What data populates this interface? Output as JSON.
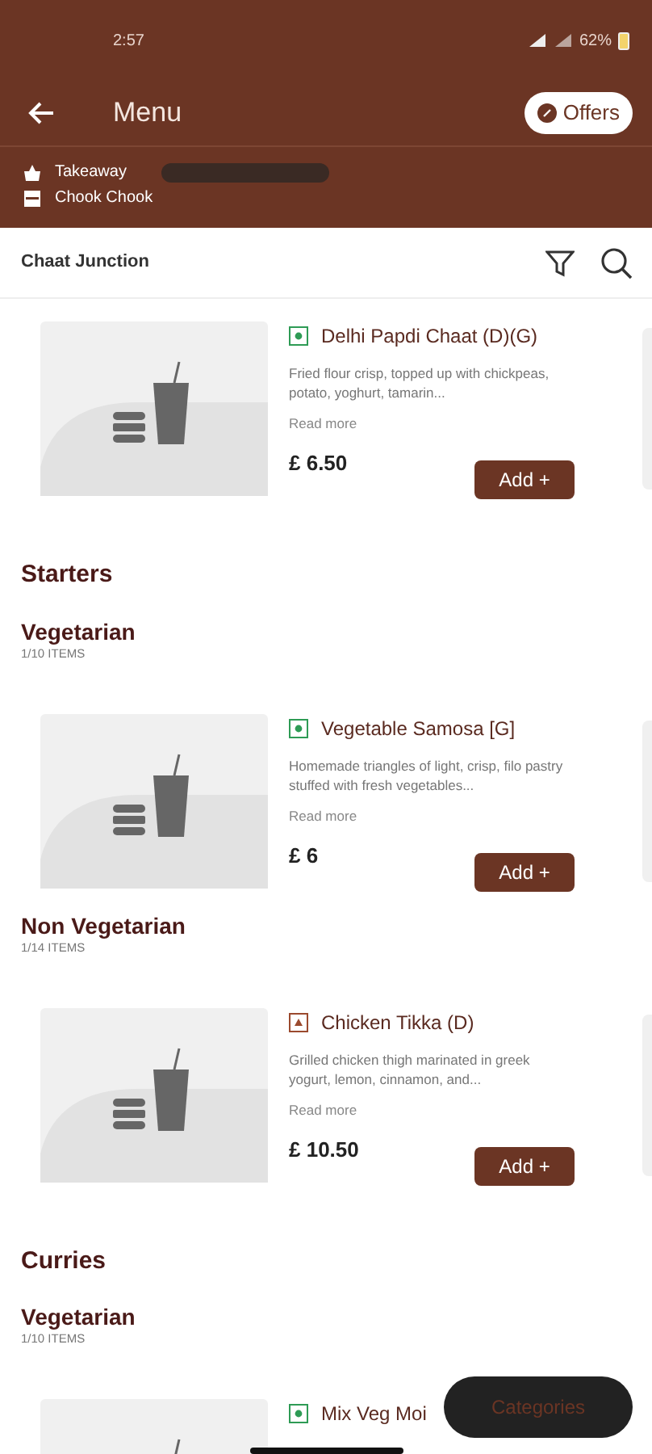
{
  "status_bar": {
    "time": "2:57",
    "battery": "62%"
  },
  "header": {
    "title": "Menu",
    "offers_button": "Offers"
  },
  "order": {
    "mode": "Takeaway",
    "restaurant": "Chook Chook"
  },
  "subheader": {
    "title": "Chaat Junction"
  },
  "blocks": [
    {
      "kind": "item",
      "veg": true,
      "name": "Delhi Papdi Chaat (D)(G)",
      "description": "Fried flour crisp, topped up with chickpeas, potato, yoghurt, tamarin...",
      "read_more": "Read more",
      "price": "£ 6.50",
      "button": "Add +"
    },
    {
      "kind": "category",
      "title": "Starters"
    },
    {
      "kind": "subcategory",
      "title": "Vegetarian",
      "count": "1/10 ITEMS"
    },
    {
      "kind": "item",
      "veg": true,
      "name": "Vegetable Samosa [G]",
      "description": "Homemade triangles of light, crisp, filo pastry stuffed with fresh vegetables...",
      "read_more": "Read more",
      "price": "£ 6",
      "button": "Add +"
    },
    {
      "kind": "subcategory",
      "title": "Non Vegetarian",
      "count": "1/14 ITEMS"
    },
    {
      "kind": "item",
      "veg": false,
      "name": "Chicken Tikka (D)",
      "description": "Grilled chicken thigh marinated in greek yogurt, lemon, cinnamon, and...",
      "read_more": "Read more",
      "price": "£ 10.50",
      "button": "Add +"
    },
    {
      "kind": "category",
      "title": "Curries"
    },
    {
      "kind": "subcategory",
      "title": "Vegetarian",
      "count": "1/10 ITEMS"
    },
    {
      "kind": "item",
      "veg": true,
      "name": "Mix Veg Moi"
    }
  ],
  "categories_button": "Categories"
}
